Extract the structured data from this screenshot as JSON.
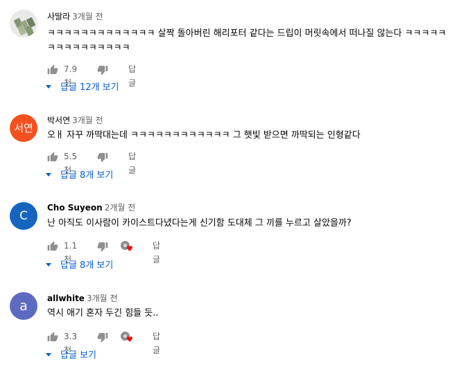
{
  "reply_label": "답글",
  "comments": [
    {
      "author": "사딸라",
      "time": "3개월 전",
      "text": "ㅋㅋㅋㅋㅋㅋㅋㅋㅋㅋㅋㅋㅋ 살짝 돌아버린 해리포터 같다는 드립이 머릿속에서 떠나질 않는다 ㅋㅋㅋㅋㅋㅋㅋㅋㅋㅋㅋㅋㅋㅋㅋ",
      "likes": "7.9천",
      "replies": "답글 12개 보기",
      "avatar": {
        "type": "image",
        "letter": ""
      }
    },
    {
      "author": "박서연",
      "time": "3개월 전",
      "text": "오ㅐ 자꾸 까딱대는데 ㅋㅋㅋㅋㅋㅋㅋㅋㅋㅋㅋㅋ 그 햇빛 받으면 까딱되는 인형같다",
      "likes": "5.5천",
      "replies": "답글 8개 보기",
      "avatar": {
        "type": "letter",
        "letter": "서연",
        "color": "#f4511e"
      }
    },
    {
      "author": "Cho Suyeon",
      "time": "2개월 전",
      "text": "난 아직도 이사람이 카이스트다녔다는게 신기함 도대체 그 끼를 누르고 살았을까?",
      "likes": "1.1천",
      "replies": "답글 8개 보기",
      "avatar": {
        "type": "letter",
        "letter": "C",
        "color": "#1565c0"
      }
    },
    {
      "author": "allwhite",
      "time": "3개월 전",
      "text": "역시 애기 혼자 두긴 힘들 듯..",
      "likes": "3.3천",
      "replies": "답글 보기",
      "avatar": {
        "type": "letter",
        "letter": "a",
        "color": "#5c6bc0"
      }
    }
  ]
}
